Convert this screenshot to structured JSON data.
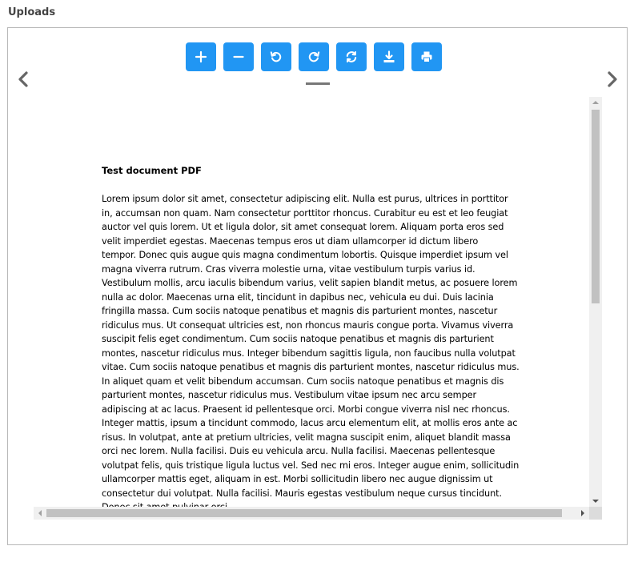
{
  "section": {
    "title": "Uploads"
  },
  "toolbar": {
    "buttons": [
      {
        "name": "zoom-in-button",
        "icon": "plus-icon"
      },
      {
        "name": "zoom-out-button",
        "icon": "minus-icon"
      },
      {
        "name": "rotate-left-button",
        "icon": "rotate-left-icon"
      },
      {
        "name": "rotate-right-button",
        "icon": "rotate-right-icon"
      },
      {
        "name": "reset-button",
        "icon": "refresh-icon"
      },
      {
        "name": "download-button",
        "icon": "download-icon"
      },
      {
        "name": "print-button",
        "icon": "print-icon"
      }
    ],
    "accent_color": "#2196f3"
  },
  "navigation": {
    "prev_icon": "chevron-left-icon",
    "next_icon": "chevron-right-icon"
  },
  "document": {
    "title": "Test document PDF",
    "body": "Lorem ipsum dolor sit amet, consectetur adipiscing elit. Nulla est purus, ultrices in porttitor\nin, accumsan non quam. Nam consectetur porttitor rhoncus. Curabitur eu est et leo feugiat\nauctor vel quis lorem. Ut et ligula dolor, sit amet consequat lorem. Aliquam porta eros sed\nvelit imperdiet egestas. Maecenas tempus eros ut diam ullamcorper id dictum libero\ntempor. Donec quis augue quis magna condimentum lobortis. Quisque imperdiet ipsum vel\nmagna viverra rutrum. Cras viverra molestie urna, vitae vestibulum turpis varius id.\nVestibulum mollis, arcu iaculis bibendum varius, velit sapien blandit metus, ac posuere lorem\nnulla ac dolor. Maecenas urna elit, tincidunt in dapibus nec, vehicula eu dui. Duis lacinia\nfringilla massa. Cum sociis natoque penatibus et magnis dis parturient montes, nascetur\nridiculus mus. Ut consequat ultricies est, non rhoncus mauris congue porta. Vivamus viverra\nsuscipit felis eget condimentum. Cum sociis natoque penatibus et magnis dis parturient\nmontes, nascetur ridiculus mus. Integer bibendum sagittis ligula, non faucibus nulla volutpat\nvitae. Cum sociis natoque penatibus et magnis dis parturient montes, nascetur ridiculus mus.\nIn aliquet quam et velit bibendum accumsan. Cum sociis natoque penatibus et magnis dis\nparturient montes, nascetur ridiculus mus. Vestibulum vitae ipsum nec arcu semper\nadipiscing at ac lacus. Praesent id pellentesque orci. Morbi congue viverra nisl nec rhoncus.\nInteger mattis, ipsum a tincidunt commodo, lacus arcu elementum elit, at mollis eros ante ac\nrisus. In volutpat, ante at pretium ultricies, velit magna suscipit enim, aliquet blandit massa\norci nec lorem. Nulla facilisi. Duis eu vehicula arcu. Nulla facilisi. Maecenas pellentesque\nvolutpat felis, quis tristique ligula luctus vel. Sed nec mi eros. Integer augue enim, sollicitudin\nullamcorper mattis eget, aliquam in est. Morbi sollicitudin libero nec augue dignissim ut\nconsectetur dui volutpat. Nulla facilisi. Mauris egestas vestibulum neque cursus tincidunt.\nDonec sit amet pulvinar orci."
  }
}
